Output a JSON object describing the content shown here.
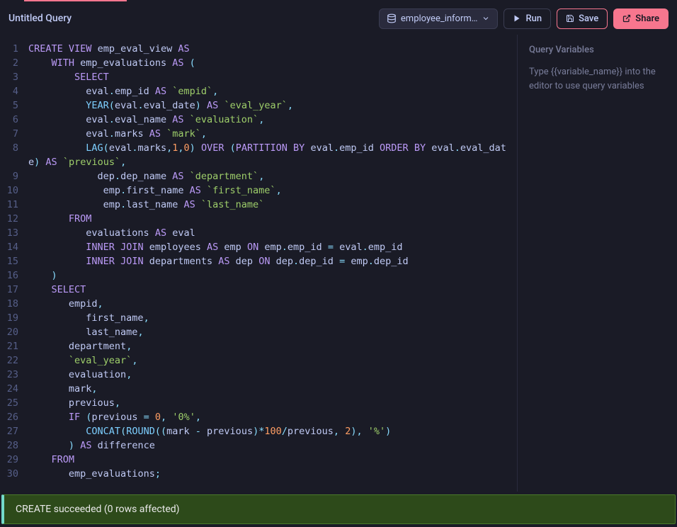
{
  "header": {
    "title": "Untitled Query",
    "database_label": "employee_inform…",
    "run_label": "Run",
    "save_label": "Save",
    "share_label": "Share"
  },
  "sidebar": {
    "title": "Query Variables",
    "help": "Type {{variable_name}} into the editor to use query variables"
  },
  "status": {
    "message": "CREATE succeeded (0 rows affected)"
  },
  "editor": {
    "line_numbers": [
      "1",
      "2",
      "3",
      "4",
      "5",
      "6",
      "7",
      "8",
      "",
      "9",
      "10",
      "11",
      "12",
      "13",
      "14",
      "15",
      "16",
      "17",
      "18",
      "19",
      "20",
      "21",
      "22",
      "23",
      "24",
      "25",
      "26",
      "27",
      "28",
      "29",
      "30"
    ]
  },
  "chart_data": null,
  "sql_source": "CREATE VIEW emp_eval_view AS\n    WITH emp_evaluations AS (\n        SELECT\n          eval.emp_id AS `empid`,\n          YEAR(eval.eval_date) AS `eval_year`,\n          eval.eval_name AS `evaluation`,\n          eval.marks AS `mark`,\n          LAG(eval.marks,1,0) OVER (PARTITION BY eval.emp_id ORDER BY eval.eval_date) AS `previous`,\n            dep.dep_name AS `department`,\n             emp.first_name AS `first_name`,\n             emp.last_name AS `last_name`\n       FROM\n          evaluations AS eval\n          INNER JOIN employees AS emp ON emp.emp_id = eval.emp_id\n          INNER JOIN departments AS dep ON dep.dep_id = emp.dep_id\n    )\n    SELECT  \n       empid,\n          first_name,\n          last_name,\n       department,\n       `eval_year`,\n       evaluation,\n       mark,\n       previous,\n       IF (previous = 0, '0%', \n          CONCAT(ROUND((mark - previous)*100/previous, 2), '%')\n       ) AS difference\n    FROM\n       emp_evaluations;"
}
